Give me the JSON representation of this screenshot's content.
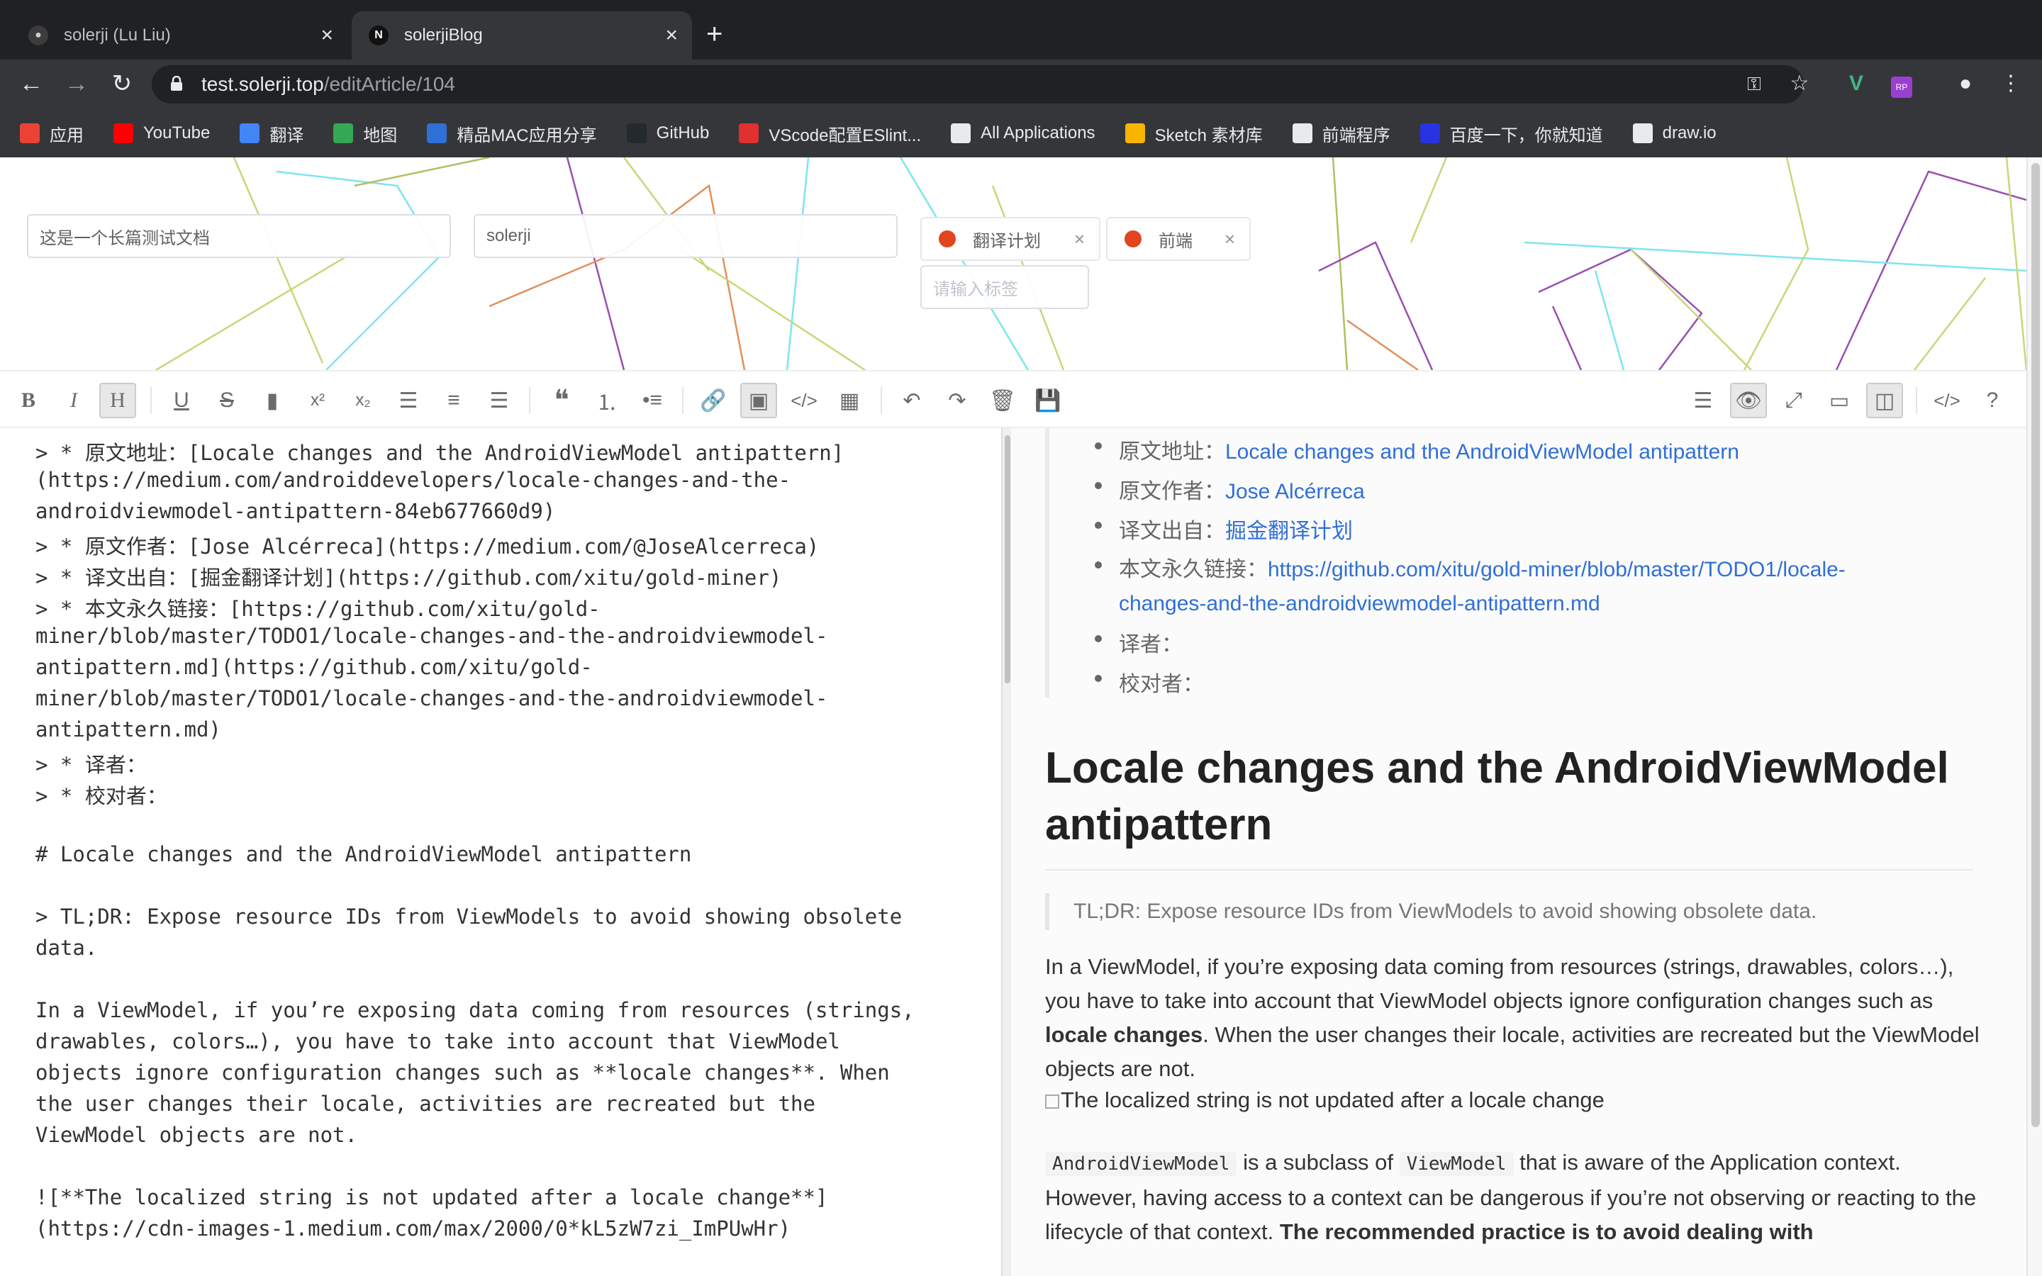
{
  "tabs": [
    {
      "title": "solerji (Lu Liu)",
      "icon": "github-icon"
    },
    {
      "title": "solerjiBlog",
      "icon": "n-icon"
    }
  ],
  "address": {
    "host": "test.solerji.top",
    "path": "/editArticle/104"
  },
  "bookmarks": [
    {
      "label": "应用",
      "icon": "apps-grid-icon",
      "color": "#ea4335"
    },
    {
      "label": "YouTube",
      "icon": "youtube-icon",
      "color": "#ff0000"
    },
    {
      "label": "翻译",
      "icon": "translate-icon",
      "color": "#4285f4"
    },
    {
      "label": "地图",
      "icon": "maps-icon",
      "color": "#34a853"
    },
    {
      "label": "精品MAC应用分享",
      "icon": "x-icon",
      "color": "#2f6fd8"
    },
    {
      "label": "GitHub",
      "icon": "github-icon",
      "color": "#24292e"
    },
    {
      "label": "VScode配置ESlint...",
      "icon": "c-icon",
      "color": "#e03030"
    },
    {
      "label": "All Applications",
      "icon": "globe-icon",
      "color": "#e8eaed"
    },
    {
      "label": "Sketch 素材库",
      "icon": "sketch-icon",
      "color": "#f7b500"
    },
    {
      "label": "前端程序",
      "icon": "folder-icon",
      "color": "#e8eaed"
    },
    {
      "label": "百度一下，你就知道",
      "icon": "baidu-icon",
      "color": "#2932e1"
    },
    {
      "label": "draw.io",
      "icon": "globe-icon",
      "color": "#e8eaed"
    }
  ],
  "form": {
    "title_value": "这是一个长篇测试文档",
    "author_value": "solerji",
    "tags": [
      "翻译计划",
      "前端"
    ],
    "tag_placeholder": "请输入标签"
  },
  "editor_lines": [
    "> * 原文地址：[Locale changes and the AndroidViewModel antipattern]",
    "(https://medium.com/androiddevelopers/locale-changes-and-the-",
    "androidviewmodel-antipattern-84eb677660d9)",
    "> * 原文作者：[Jose Alcérreca](https://medium.com/@JoseAlcerreca)",
    "> * 译文出自：[掘金翻译计划](https://github.com/xitu/gold-miner)",
    "> * 本文永久链接：[https://github.com/xitu/gold-",
    "miner/blob/master/TODO1/locale-changes-and-the-androidviewmodel-",
    "antipattern.md](https://github.com/xitu/gold-",
    "miner/blob/master/TODO1/locale-changes-and-the-androidviewmodel-",
    "antipattern.md)",
    "> * 译者：",
    "> * 校对者：",
    "",
    "# Locale changes and the AndroidViewModel antipattern",
    "",
    "> TL;DR: Expose resource IDs from ViewModels to avoid showing obsolete",
    "data.",
    "",
    "In a ViewModel, if you’re exposing data coming from resources (strings,",
    "drawables, colors…), you have to take into account that ViewModel",
    "objects ignore configuration changes such as **locale changes**. When",
    "the user changes their locale, activities are recreated but the",
    "ViewModel objects are not.",
    "",
    "![**The localized string is not updated after a locale change**]",
    "(https://cdn-images-1.medium.com/max/2000/0*kL5zW7zi_ImPUwHr)"
  ],
  "preview": {
    "meta": [
      {
        "label": "原文地址：",
        "link": "Locale changes and the AndroidViewModel antipattern"
      },
      {
        "label": "原文作者：",
        "link": "Jose Alcérreca"
      },
      {
        "label": "译文出自：",
        "link": "掘金翻译计划"
      },
      {
        "label": "本文永久链接：",
        "link": "https://github.com/xitu/gold-miner/blob/master/TODO1/locale-",
        "link2": "changes-and-the-androidviewmodel-antipattern.md"
      },
      {
        "label": "译者：",
        "link": ""
      },
      {
        "label": "校对者：",
        "link": ""
      }
    ],
    "heading": "Locale changes and the AndroidViewModel antipattern",
    "tldr": "TL;DR: Expose resource IDs from ViewModels to avoid showing obsolete data.",
    "p1_a": "In a ViewModel, if you’re exposing data coming from resources (strings, drawables, colors…), you have to take into account that ViewModel objects ignore configuration changes such as ",
    "p1_bold": "locale changes",
    "p1_b": ". When the user changes their locale, activities are recreated but the ViewModel objects are not.",
    "img_alt": "The localized string is not updated after a locale change",
    "p2_code1": "AndroidViewModel",
    "p2_a": " is a subclass of ",
    "p2_code2": "ViewModel",
    "p2_b": " that is aware of the Application context. However, having access to a context can be dangerous if you’re not observing or reacting to the lifecycle of that context. ",
    "p2_bold": "The recommended practice is to avoid dealing with"
  }
}
